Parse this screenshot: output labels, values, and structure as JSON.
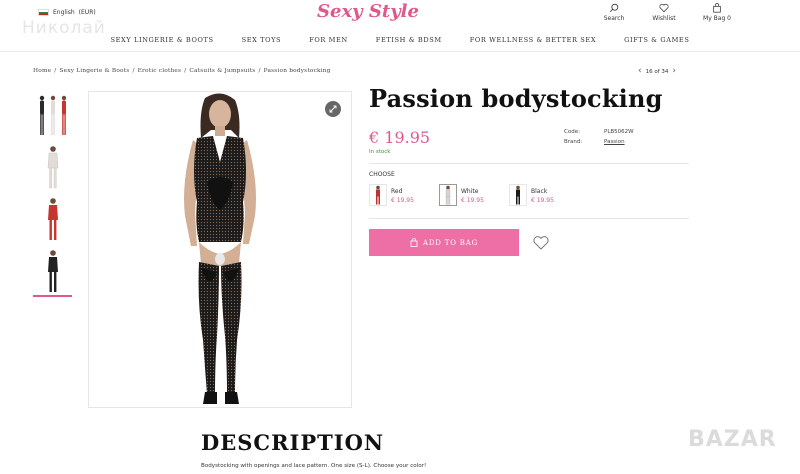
{
  "header": {
    "language_label": "English",
    "currency_label": "(EUR)",
    "watermark_name": "Николай",
    "logo_text": "Sexy Style",
    "actions": [
      {
        "label": "Search",
        "icon": "search-icon"
      },
      {
        "label": "Wishlist",
        "icon": "heart-icon"
      },
      {
        "label": "My Bag 0",
        "icon": "bag-icon"
      }
    ]
  },
  "nav": {
    "items": [
      "SEXY LINGERIE & BOOTS",
      "SEX TOYS",
      "FOR MEN",
      "FETISH & BDSM",
      "FOR WELLNESS & BETTER SEX",
      "GIFTS & GAMES"
    ]
  },
  "breadcrumb": {
    "items": [
      "Home",
      "Sexy Lingerie & Boots",
      "Erotic clothes",
      "Catsuits & Jumpsuits",
      "Passion bodystocking"
    ]
  },
  "pager": {
    "label": "16 of 34"
  },
  "product": {
    "title": "Passion bodystocking",
    "price": "€ 19.95",
    "stock": "In stock",
    "code_label": "Code:",
    "code_value": "PLB5062W",
    "brand_label": "Brand:",
    "brand_value": "Passion",
    "choose_label": "CHOOSE",
    "variants": [
      {
        "name": "Red",
        "price": "€ 19.95",
        "color": "#c0302e"
      },
      {
        "name": "White",
        "price": "€ 19.95",
        "color": "#d9d2cc"
      },
      {
        "name": "Black",
        "price": "€ 19.95",
        "color": "#1a1a1a"
      }
    ],
    "add_to_bag_label": "ADD TO BAG"
  },
  "description": {
    "title": "DESCRIPTION",
    "text": "Bodystocking with openings and lace pattern. One size (S-L). Choose your color!"
  },
  "watermark_bazar": "BAZAR",
  "colors": {
    "accent": "#e0578a",
    "button": "#ed6fa6",
    "stock_green": "#4a8c3a"
  }
}
